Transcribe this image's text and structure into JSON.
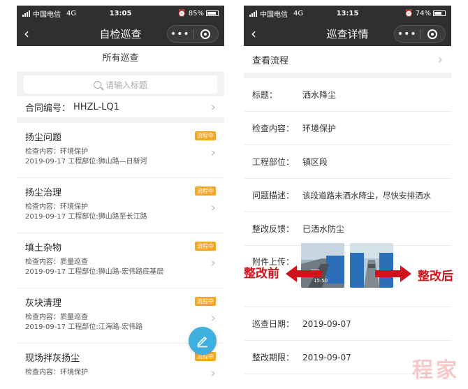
{
  "left": {
    "status": {
      "carrier": "中国电信",
      "network": "4G",
      "time": "13:05",
      "battery": "85%",
      "battery_level": 0.85
    },
    "nav": {
      "back": "‹",
      "title": "自检巡查",
      "more": "•••"
    },
    "section_title": "所有巡查",
    "search": {
      "placeholder": "请输入标题"
    },
    "contract": {
      "label": "合同编号：",
      "value": "HHZL-LQ1"
    },
    "items": [
      {
        "title": "扬尘问题",
        "badge": "流程中",
        "line1": "检查内容：环境保护",
        "line2": "2019-09-17 工程部位:狮山路—日新河"
      },
      {
        "title": "扬尘治理",
        "badge": "流程中",
        "line1": "检查内容：环境保护",
        "line2": "2019-09-17 工程部位:狮山路至长江路"
      },
      {
        "title": "填土杂物",
        "badge": "流程中",
        "line1": "检查内容：质量巡查",
        "line2": "2019-09-17 工程部位:狮山路-宏伟路底基层"
      },
      {
        "title": "灰块清理",
        "badge": "流程中",
        "line1": "检查内容：质量巡查",
        "line2": "2019-09-17 工程部位:江海路-宏伟路"
      },
      {
        "title": "现场拌灰扬尘",
        "badge": "流程中",
        "line1": "检查内容：环境保护",
        "line2": ""
      }
    ],
    "fab_icon": "edit-icon"
  },
  "right": {
    "status": {
      "carrier": "中国电信",
      "network": "4G",
      "time": "13:15",
      "battery": "74%",
      "battery_level": 0.74
    },
    "nav": {
      "back": "‹",
      "title": "巡查详情",
      "more": "•••"
    },
    "flow": "查看流程",
    "fields": [
      {
        "label": "标题：",
        "value": "洒水降尘"
      },
      {
        "label": "检查内容：",
        "value": "环境保护"
      },
      {
        "label": "工程部位：",
        "value": "镇区段"
      },
      {
        "label": "问题描述：",
        "value": "该段道路未洒水降尘，尽快安排洒水"
      },
      {
        "label": "整改反馈：",
        "value": "已洒水防尘"
      }
    ],
    "attach_label": "附件上传：",
    "photo_time": "15:50",
    "dates": [
      {
        "label": "巡查日期：",
        "value": "2019-09-07"
      },
      {
        "label": "整改期限：",
        "value": "2019-09-07"
      }
    ]
  },
  "annotations": {
    "before": "整改前",
    "after": "整改后",
    "color": "#d0121b"
  },
  "watermark": "程家"
}
